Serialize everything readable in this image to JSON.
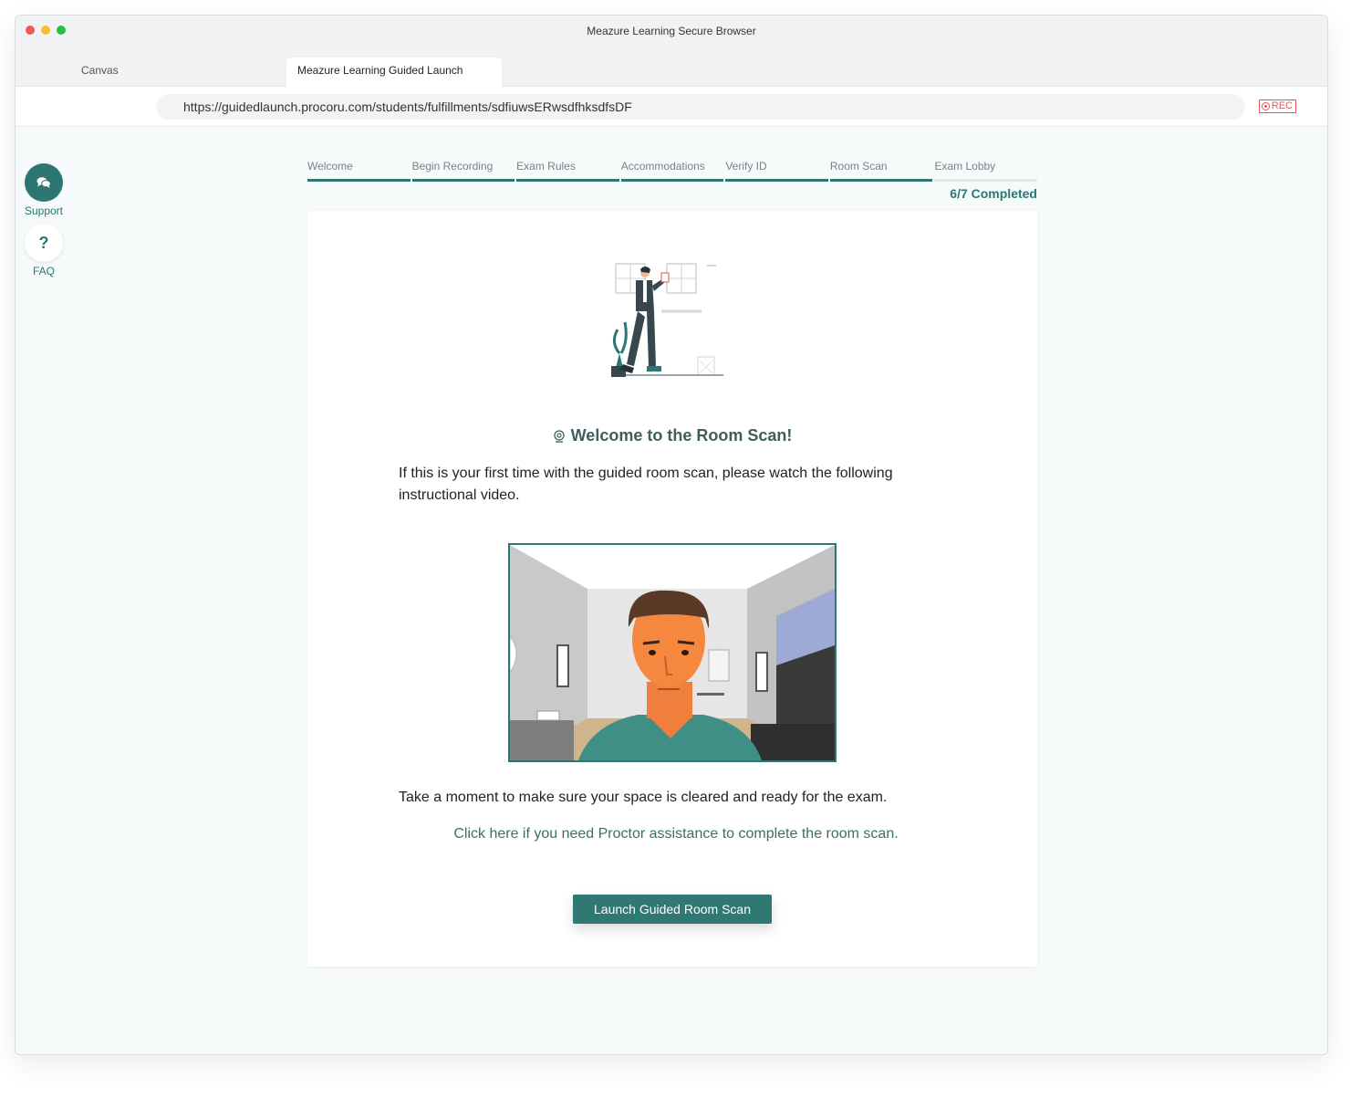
{
  "window": {
    "title": "Meazure Learning Secure Browser"
  },
  "tabs": [
    {
      "label": "Canvas"
    },
    {
      "label": "Meazure Learning Guided Launch"
    }
  ],
  "address": {
    "url": "https://guidedlaunch.procoru.com/students/fulfillments/sdfiuwsERwsdfhksdfsDF",
    "rec_label": "REC"
  },
  "sidebar": {
    "support_label": "Support",
    "faq_label": "FAQ",
    "faq_glyph": "?"
  },
  "steps": [
    {
      "label": "Welcome",
      "done": true
    },
    {
      "label": "Begin Recording",
      "done": true
    },
    {
      "label": "Exam Rules",
      "done": true
    },
    {
      "label": "Accommodations",
      "done": true
    },
    {
      "label": "Verify ID",
      "done": true
    },
    {
      "label": "Room Scan",
      "done": true
    },
    {
      "label": "Exam Lobby",
      "done": false
    }
  ],
  "progress": {
    "text": "6/7 Completed",
    "completed": 6,
    "total": 7
  },
  "card": {
    "title": "Welcome to the Room Scan!",
    "intro": "If this is your first time with the guided room scan, please watch the following instructional video.",
    "ready": "Take a moment to make sure your space is cleared and ready for the exam.",
    "proctor_link": "Click here if you need Proctor assistance to complete the room scan.",
    "launch_label": "Launch Guided Room Scan"
  },
  "colors": {
    "accent": "#2c7673",
    "rec": "#e05656"
  }
}
